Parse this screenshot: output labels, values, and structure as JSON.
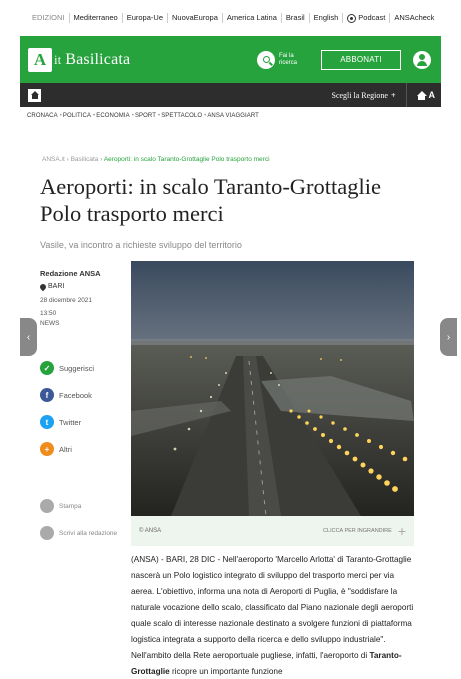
{
  "editions": {
    "items": [
      "EDIZIONI",
      "Mediterraneo",
      "Europa-Ue",
      "NuovaEuropa",
      "America Latina",
      "Brasil",
      "English",
      "Podcast",
      "ANSAcheck"
    ]
  },
  "header": {
    "logo": "A",
    "logo_suffix": "it",
    "region": "Basilicata",
    "search_label": "Fai la ricerca",
    "subscribe": "ABBONATI"
  },
  "darkbar": {
    "choose_region": "Scegli la Regione",
    "plus": "+",
    "house_letter": "A"
  },
  "categories": [
    "CRONACA",
    "POLITICA",
    "ECONOMIA",
    "SPORT",
    "SPETTACOLO",
    "ANSA VIAGGIART"
  ],
  "breadcrumb": {
    "items": [
      "ANSA.it",
      "Basilicata"
    ],
    "current": "Aeroporti: in scalo Taranto-Grottaglie Polo trasporto merci"
  },
  "article": {
    "title": "Aeroporti: in scalo Taranto-Grottaglie Polo trasporto merci",
    "subtitle": "Vasile, va incontro a richieste sviluppo del territorio",
    "author": "Redazione ANSA",
    "place": "BARI",
    "date": "28 dicembre 2021",
    "time": "13:50",
    "type": "NEWS",
    "photo_credit": "© ANSA",
    "enlarge_label": "CLICCA PER INGRANDIRE",
    "body_lead": "(ANSA) - BARI, 28 DIC - Nell'aeroporto 'Marcello Arlotta' di Taranto-Grottaglie nascerà un Polo logistico integrato di sviluppo del trasporto merci per via aerea. L'obiettivo, informa una nota di Aeroporti di Puglia, è \"soddisfare la naturale vocazione dello scalo, classificato dal Piano nazionale degli aeroporti quale scalo di interesse nazionale destinato a svolgere funzioni di piattaforma logistica integrata a supporto della ricerca e dello sviluppo industriale\". Nell'ambito della Rete aeroportuale pugliese, infatti, l'aeroporto di ",
    "body_bold": "Taranto-Grottaglie",
    "body_tail": " ricopre un importante funzione"
  },
  "share": {
    "suggest": "Suggerisci",
    "facebook": "Facebook",
    "twitter": "Twitter",
    "other": "Altri"
  },
  "tools": {
    "print": "Stampa",
    "write": "Scrivi alla redazione"
  },
  "colors": {
    "brand_green": "#27a33e",
    "dark_bar": "#2d2d2d"
  }
}
